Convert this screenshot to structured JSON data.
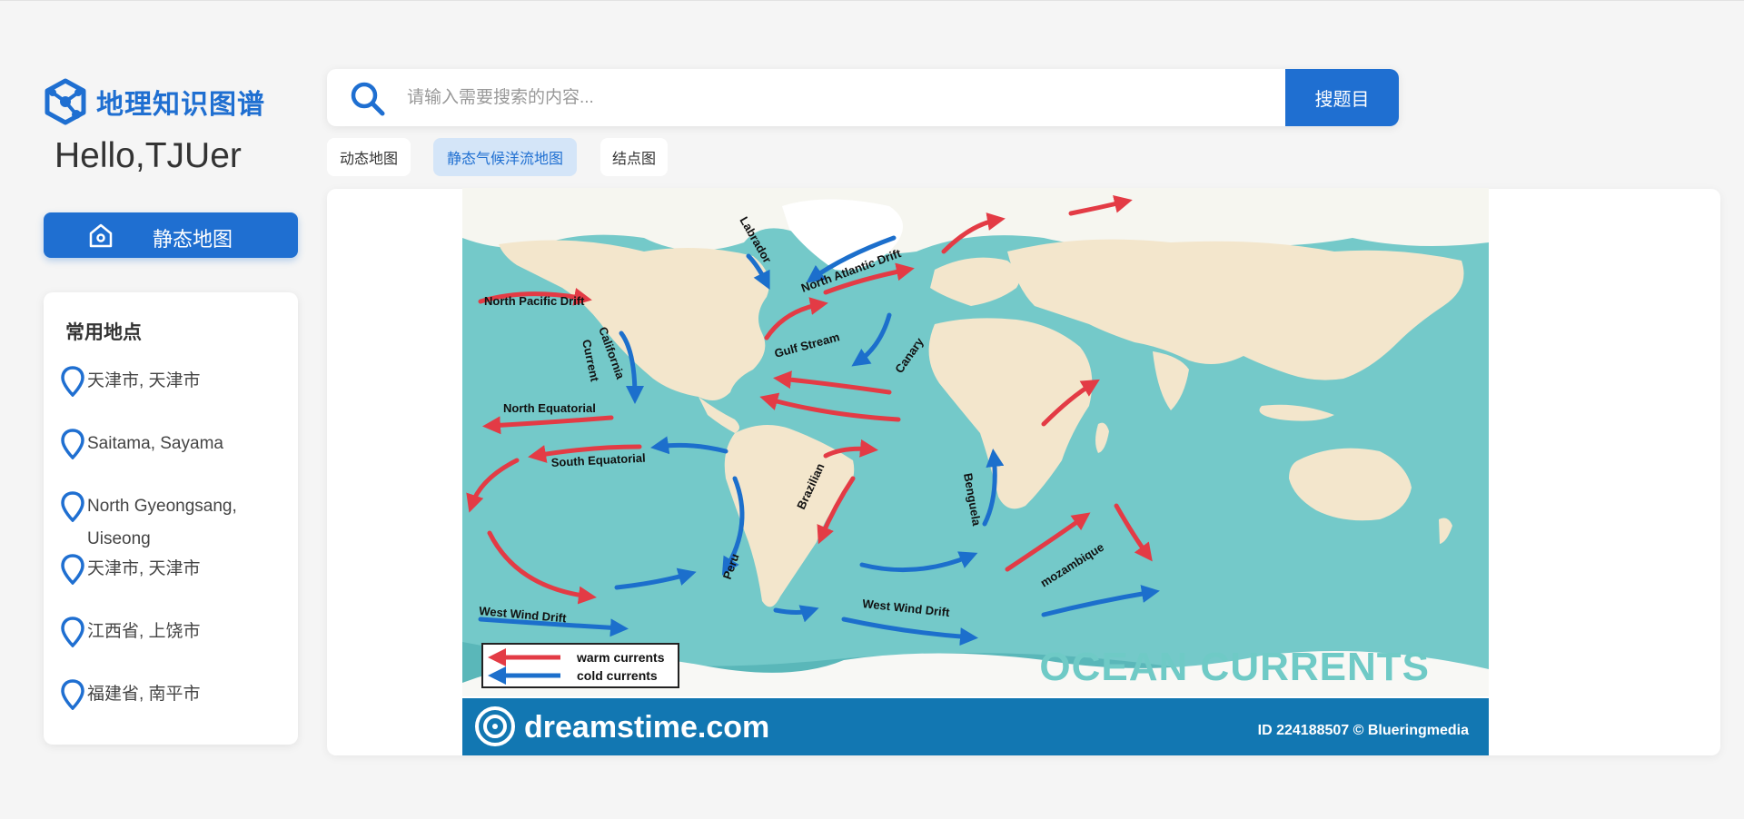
{
  "app": {
    "title": "地理知识图谱",
    "greeting": "Hello,TJUer"
  },
  "sidebar": {
    "nav_label": "静态地图",
    "places_title": "常用地点",
    "places": [
      {
        "label": "天津市, 天津市"
      },
      {
        "label": "Saitama, Sayama"
      },
      {
        "label": "North Gyeongsang, Uiseong"
      },
      {
        "label": "天津市, 天津市"
      },
      {
        "label": "江西省, 上饶市"
      },
      {
        "label": "福建省, 南平市"
      }
    ]
  },
  "search": {
    "placeholder": "请输入需要搜索的内容...",
    "button_label": "搜题目"
  },
  "tabs": [
    {
      "label": "动态地图",
      "active": false
    },
    {
      "label": "静态气候洋流地图",
      "active": true
    },
    {
      "label": "结点图",
      "active": false
    }
  ],
  "map": {
    "title": "OCEAN CURRENTS",
    "legend": {
      "warm": "warm currents",
      "cold": "cold currents"
    },
    "footer_brand": "dreamstime.com",
    "footer_id": "ID 224188507 © Blueringmedia",
    "labels": {
      "north_pacific_drift": "North Pacific Drift",
      "california": "California",
      "current": "Current",
      "labrador": "Labrador",
      "north_atlantic_drift": "North Atlantic Drift",
      "gulf_stream": "Gulf Stream",
      "canary": "Canary",
      "north_equatorial": "North Equatorial",
      "south_equatorial": "South Equatorial",
      "brazilian": "Brazilian",
      "benguela": "Benguela",
      "peru": "Peru",
      "west_wind_drift_1": "West Wind Drift",
      "west_wind_drift_2": "West Wind Drift",
      "mozambique": "mozambique"
    },
    "colors": {
      "ocean": "#74c9c9",
      "land": "#f3e6cc",
      "warm": "#e33b45",
      "cold": "#1c6fcc",
      "footer": "#1277b2",
      "title": "#6fcac6"
    }
  }
}
